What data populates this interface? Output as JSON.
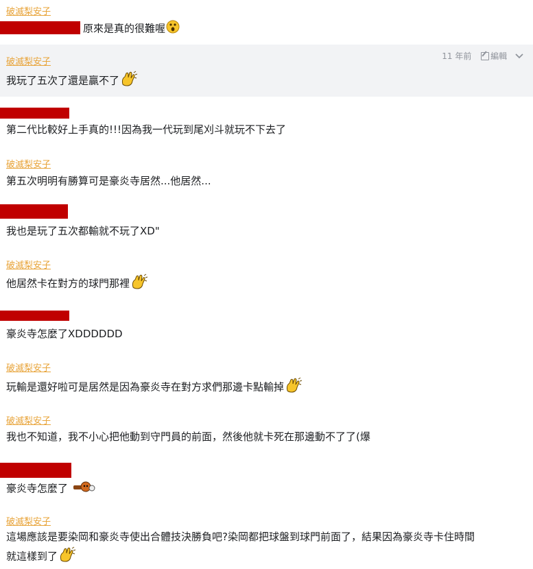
{
  "messages": [
    {
      "author": "破滅梨安子",
      "text": "原來是真的很難喔"
    },
    {
      "author": "破滅梨安子",
      "text": "我玩了五次了還是贏不了",
      "time": "11 年前",
      "edit": "編輯"
    },
    {
      "author": "",
      "text": "第二代比較好上手真的!!!因為我一代玩到尾刈斗就玩不下去了"
    },
    {
      "author": "破滅梨安子",
      "text": "第五次明明有勝算可是豪炎寺居然...他居然..."
    },
    {
      "author": "",
      "text": "我也是玩了五次都輸就不玩了XD\""
    },
    {
      "author": "破滅梨安子",
      "text": "他居然卡在對方的球門那裡"
    },
    {
      "author": "",
      "text": "豪炎寺怎麼了XDDDDDD"
    },
    {
      "author": "破滅梨安子",
      "text": "玩輸是還好啦可是居然是因為豪炎寺在對方求們那邊卡點輸掉"
    },
    {
      "author": "破滅梨安子",
      "text": "我也不知道，我不小心把他動到守門員的前面，然後他就卡死在那邊動不了了(爆"
    },
    {
      "author": "",
      "text": "豪炎寺怎麼了"
    },
    {
      "author": "破滅梨安子",
      "text": "這場應該是要染岡和豪炎寺使出合體技決勝負吧?染岡都把球盤到球門前面了，結果因為豪炎寺卡住時間",
      "text2": "就這樣到了"
    }
  ],
  "icons": {
    "surprised": "surprised-emoji-icon",
    "wave": "waving-hand-emoji-icon",
    "ko": "knocked-out-emoji-icon",
    "pencil": "pencil-icon",
    "chevron": "chevron-down-icon"
  },
  "colors": {
    "author": "#e8a43a",
    "redacted": "#c00000",
    "highlight": "#f2f3f5",
    "meta": "#90949c"
  }
}
